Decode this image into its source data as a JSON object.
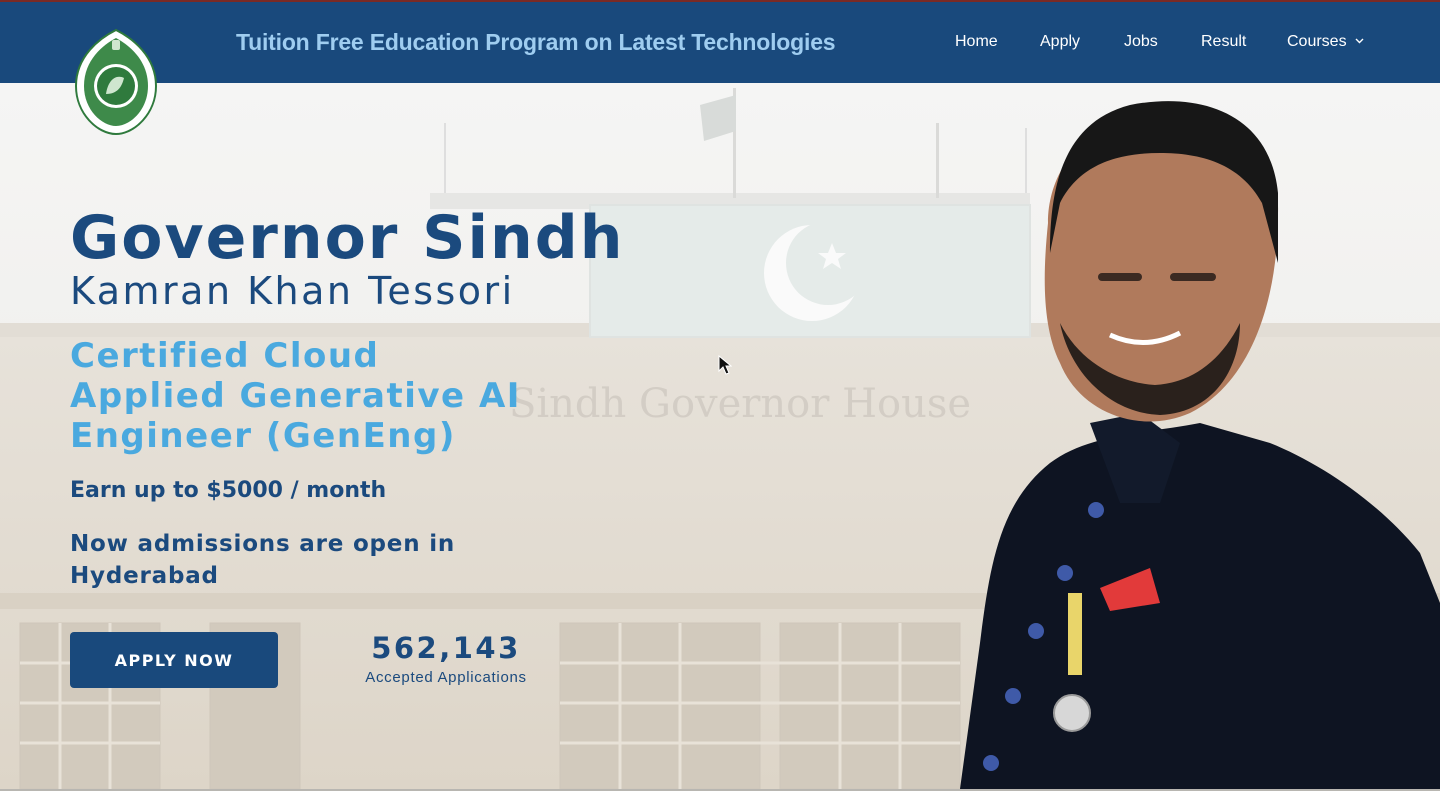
{
  "nav": {
    "title": "Tuition Free Education Program on Latest Technologies",
    "links": [
      "Home",
      "Apply",
      "Jobs",
      "Result",
      "Courses"
    ]
  },
  "hero": {
    "heading": "Governor Sindh",
    "subheading": "Kamran Khan Tessori",
    "program_lines": [
      "Certified Cloud",
      "Applied Generative AI",
      "Engineer (GenEng)"
    ],
    "earn": "Earn up to $5000 / month",
    "admissions_lines": [
      "Now admissions are open in",
      "Hyderabad"
    ],
    "apply_label": "APPLY NOW",
    "applications_count": "562,143",
    "applications_label": "Accepted Applications",
    "background_building_sign": "Sindh Governor House"
  },
  "colors": {
    "nav_bg": "#19497c",
    "title_accent": "#9fcdf0",
    "heading": "#1b4a7e",
    "program_accent": "#4aa9df"
  },
  "icons": [
    "emblem-logo",
    "chevron-down-icon",
    "mouse-cursor-icon"
  ]
}
